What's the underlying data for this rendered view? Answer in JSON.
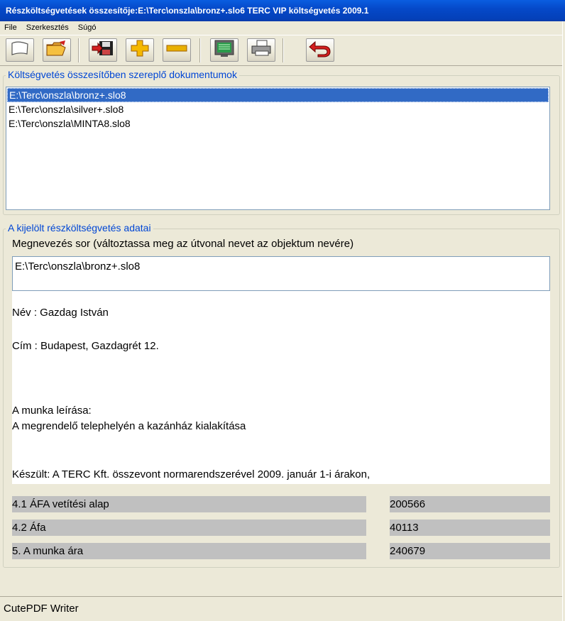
{
  "window": {
    "title": "Részköltségvetések összesítője:E:\\Terc\\onszla\\bronz+.slo6   TERC VIP költségvetés 2009.1"
  },
  "menu": [
    {
      "label": "File"
    },
    {
      "label": "Szerkesztés"
    },
    {
      "label": "Súgó"
    }
  ],
  "toolbar": {
    "icons": [
      "new-document-icon",
      "open-folder-icon",
      "import-save-icon",
      "add-icon",
      "remove-icon",
      "preview-screen-icon",
      "print-icon",
      "back-undo-icon"
    ],
    "colors": {
      "accent": "#316ac5",
      "add": "#f5b800",
      "remove": "#e8b000",
      "back": "#d42020"
    }
  },
  "documents": {
    "legend": "Költségvetés összesítőben szereplő dokumentumok",
    "items": [
      {
        "path": "E:\\Terc\\onszla\\bronz+.slo8",
        "selected": true
      },
      {
        "path": "E:\\Terc\\onszla\\silver+.slo8",
        "selected": false
      },
      {
        "path": "E:\\Terc\\onszla\\MINTA8.slo8",
        "selected": false
      }
    ]
  },
  "details": {
    "legend": "A kijelölt részköltségvetés adatai",
    "name_label": "Megnevezés sor (változtassa meg az útvonal nevet az objektum nevére)",
    "name_value": "E:\\Terc\\onszla\\bronz+.slo8",
    "nev": "Név : Gazdag István",
    "cim": "Cím : Budapest, Gazdagrét 12.",
    "munka_leiras_label": "A munka leírása:",
    "munka_leiras": "A megrendelő telephelyén a kazánház kialakítása",
    "keszult": "Készült: A TERC Kft. összevont normarendszerével 2009. január 1-i árakon,",
    "totals": [
      {
        "label": "4.1 ÁFA vetítési alap",
        "value": "200566"
      },
      {
        "label": "4.2 Áfa",
        "value": "40113"
      },
      {
        "label": "5.  A munka ára",
        "value": "240679"
      }
    ]
  },
  "status": {
    "text": "CutePDF Writer"
  }
}
